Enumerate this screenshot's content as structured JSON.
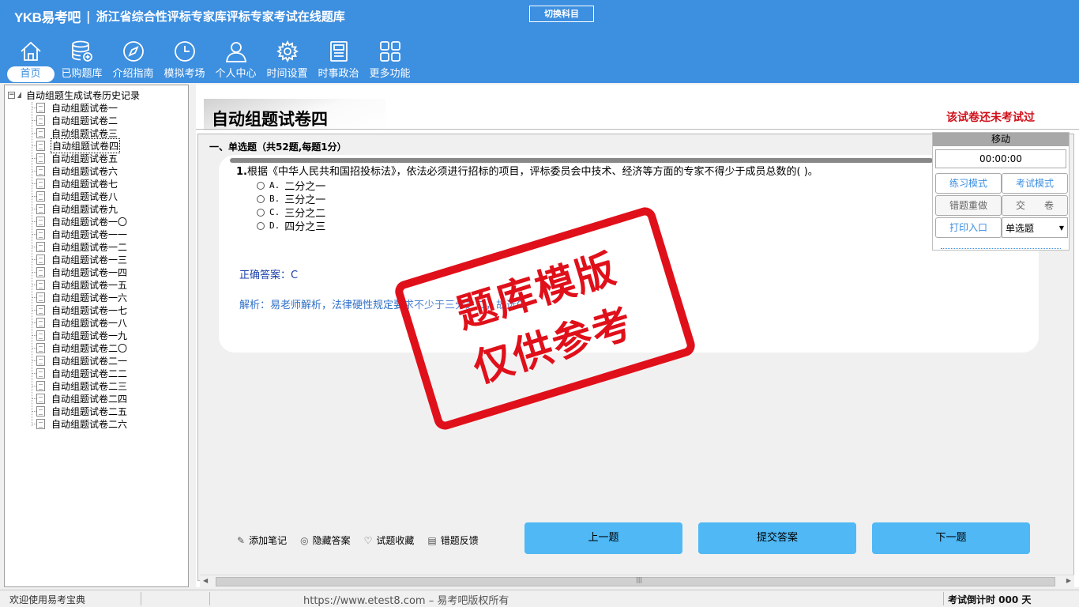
{
  "header": {
    "logo": "YKB易考吧",
    "separator": "|",
    "title": "浙江省综合性评标专家库评标专家考试在线题库",
    "switch_label": "切换科目"
  },
  "nav": [
    {
      "label": "首页",
      "icon": "home-icon"
    },
    {
      "label": "已购题库",
      "icon": "database-icon"
    },
    {
      "label": "介绍指南",
      "icon": "compass-icon"
    },
    {
      "label": "模拟考场",
      "icon": "clock-icon"
    },
    {
      "label": "个人中心",
      "icon": "user-icon"
    },
    {
      "label": "时间设置",
      "icon": "gear-icon"
    },
    {
      "label": "时事政治",
      "icon": "news-icon"
    },
    {
      "label": "更多功能",
      "icon": "grid-icon"
    }
  ],
  "tree": {
    "root": "自动组题生成试卷历史记录",
    "items": [
      "自动组题试卷一",
      "自动组题试卷二",
      "自动组题试卷三",
      "自动组题试卷四",
      "自动组题试卷五",
      "自动组题试卷六",
      "自动组题试卷七",
      "自动组题试卷八",
      "自动组题试卷九",
      "自动组题试卷一〇",
      "自动组题试卷一一",
      "自动组题试卷一二",
      "自动组题试卷一三",
      "自动组题试卷一四",
      "自动组题试卷一五",
      "自动组题试卷一六",
      "自动组题试卷一七",
      "自动组题试卷一八",
      "自动组题试卷一九",
      "自动组题试卷二〇",
      "自动组题试卷二一",
      "自动组题试卷二二",
      "自动组题试卷二三",
      "自动组题试卷二四",
      "自动组题试卷二五",
      "自动组题试卷二六"
    ],
    "selected_index": 3
  },
  "paper": {
    "title": "自动组题试卷四",
    "status": "该试卷还未考试过",
    "section": "一、单选题（共52题,每题1分）"
  },
  "question": {
    "number": "1.",
    "text": "根据《中华人民共和国招投标法》，依法必须进行招标的项目，评标委员会中技术、经济等方面的专家不得少于成员总数的( )。",
    "options": [
      {
        "key": "A.",
        "text": "二分之一"
      },
      {
        "key": "B.",
        "text": "三分之一"
      },
      {
        "key": "C.",
        "text": "三分之二"
      },
      {
        "key": "D.",
        "text": "四分之三"
      }
    ],
    "answer": "正确答案：C",
    "analysis": "解析：易老师解析，法律硬性规定要求不少于三分之二，故选C。"
  },
  "stamp": {
    "line1": "题库模版",
    "line2": "仅供参考"
  },
  "panel": {
    "move": "移动",
    "timer": "00:00:00",
    "practice": "练习模式",
    "exam": "考试模式",
    "redo": "错题重做",
    "submit_paper": "交　　卷",
    "print": "打印入口",
    "type_select": "单选题"
  },
  "tools": [
    {
      "label": "添加笔记",
      "icon": "pencil-icon"
    },
    {
      "label": "隐藏答案",
      "icon": "eye-icon"
    },
    {
      "label": "试题收藏",
      "icon": "heart-icon"
    },
    {
      "label": "错题反馈",
      "icon": "feedback-icon"
    }
  ],
  "buttons": {
    "prev": "上一题",
    "submit": "提交答案",
    "next": "下一题"
  },
  "status": {
    "welcome": "欢迎使用易考宝典",
    "url": "https://www.etest8.com – 易考吧版权所有",
    "countdown": "考试倒计时 000 天"
  },
  "colors": {
    "header": "#3d8fe0",
    "button": "#4fb8f5",
    "stamp": "#e0101a",
    "status_red": "#d0101a"
  }
}
